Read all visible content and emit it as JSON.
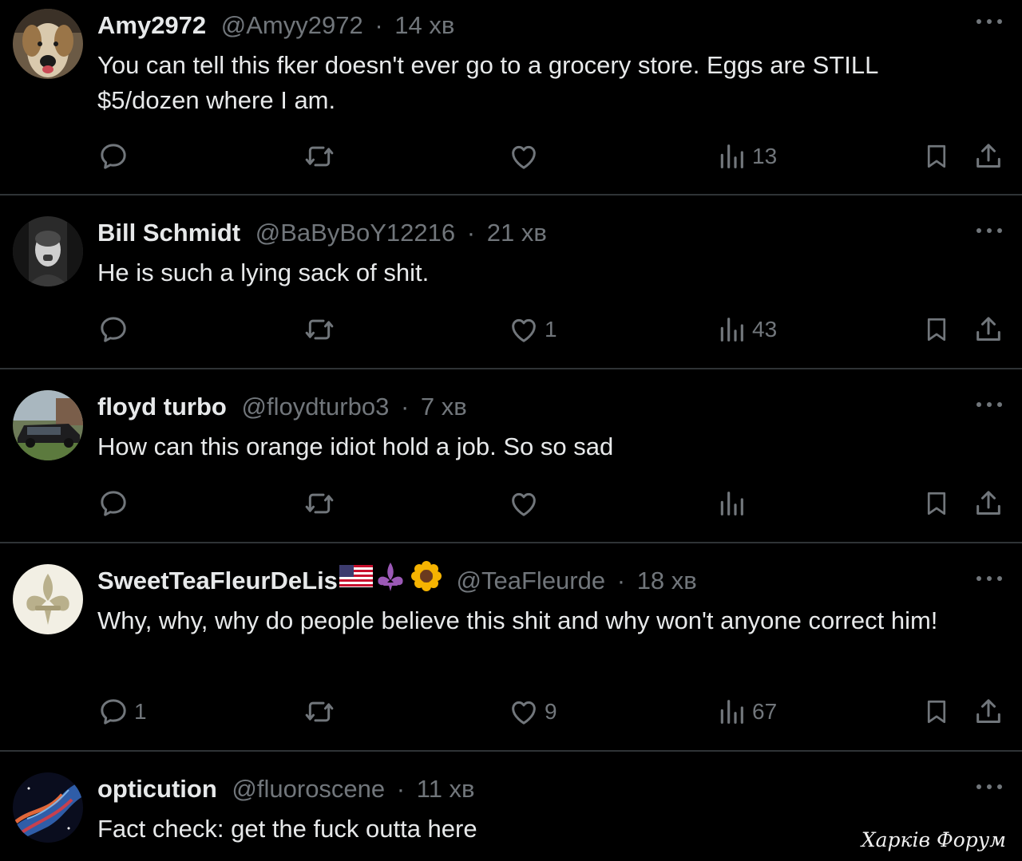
{
  "colors": {
    "background": "#000000",
    "text": "#e7e9ea",
    "muted": "#71767b",
    "divider": "#2f3336"
  },
  "icons": {
    "reply": "speech-bubble-icon",
    "retweet": "retweet-arrows-icon",
    "like": "heart-icon",
    "views": "bar-chart-icon",
    "bookmark": "bookmark-icon",
    "share": "share-upload-icon",
    "more": "ellipsis-icon"
  },
  "tweets": [
    {
      "name": "Amy2972",
      "handle": "@Amyy2972",
      "dot": "·",
      "time": "14 хв",
      "text": "You can tell this fker doesn't ever go to a grocery store. Eggs are STILL $5/dozen where I am.",
      "replies": "",
      "retweets": "",
      "likes": "",
      "views": "13"
    },
    {
      "name": "Bill Schmidt",
      "handle": "@BaByBoY12216",
      "dot": "·",
      "time": "21 хв",
      "text": "He is such a lying sack of shit.",
      "replies": "",
      "retweets": "",
      "likes": "1",
      "views": "43"
    },
    {
      "name": "floyd turbo",
      "handle": "@floydturbo3",
      "dot": "·",
      "time": "7 хв",
      "text": "How can this orange idiot hold a job. So so sad",
      "replies": "",
      "retweets": "",
      "likes": "",
      "views": ""
    },
    {
      "name": "SweetTeaFleurDeLis",
      "name_emojis": [
        "us-flag",
        "fleur-de-lis-purple",
        "sunflower"
      ],
      "handle": "@TeaFleurde",
      "dot": "·",
      "time": "18 хв",
      "text": "Why, why, why do people believe this shit and why won't anyone correct him!",
      "replies": "1",
      "retweets": "",
      "likes": "9",
      "views": "67"
    },
    {
      "name": "opticution",
      "handle": "@fluoroscene",
      "dot": "·",
      "time": "11 хв",
      "text": "Fact check: get the fuck outta here"
    }
  ],
  "watermark": "Харків Форум"
}
